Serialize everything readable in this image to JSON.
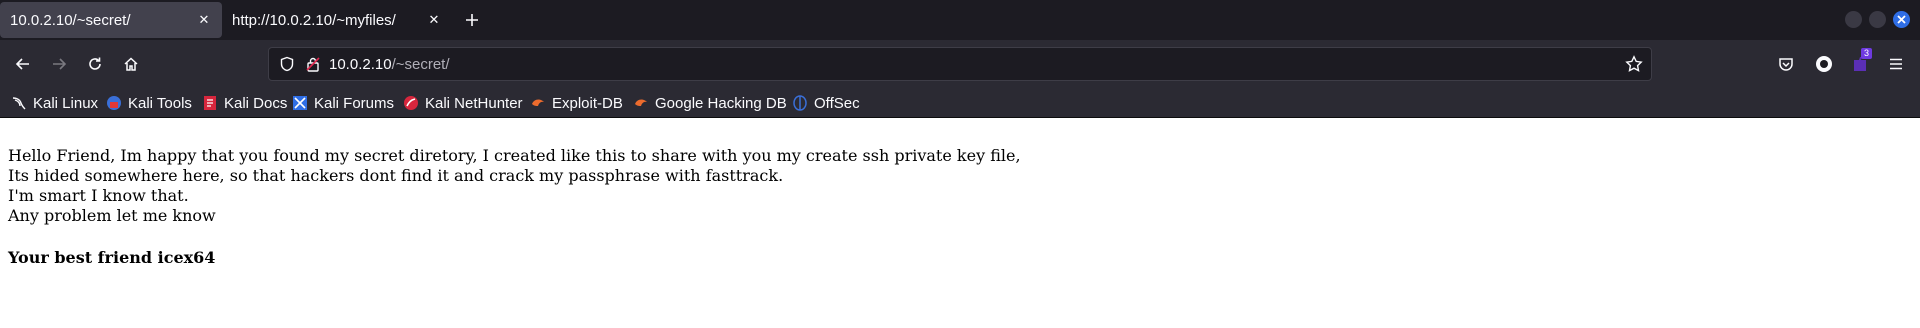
{
  "tabs": [
    {
      "title": "10.0.2.10/~secret/",
      "active": true
    },
    {
      "title": "http://10.0.2.10/~myfiles/",
      "active": false
    }
  ],
  "url": {
    "host": "10.0.2.10",
    "path": "/~secret/"
  },
  "bookmarks": [
    {
      "label": "Kali Linux",
      "icon": "kali-dragon-icon"
    },
    {
      "label": "Kali Tools",
      "icon": "kali-tools-icon"
    },
    {
      "label": "Kali Docs",
      "icon": "kali-docs-icon"
    },
    {
      "label": "Kali Forums",
      "icon": "kali-forums-icon"
    },
    {
      "label": "Kali NetHunter",
      "icon": "kali-nethunter-icon"
    },
    {
      "label": "Exploit-DB",
      "icon": "exploit-db-icon"
    },
    {
      "label": "Google Hacking DB",
      "icon": "ghdb-icon"
    },
    {
      "label": "OffSec",
      "icon": "offsec-icon"
    }
  ],
  "extension_badge": "3",
  "page": {
    "lines": [
      "Hello Friend, Im happy that you found my secret diretory, I created like this to share with you my create ssh private key file,",
      "Its hided somewhere here, so that hackers dont find it and crack my passphrase with fasttrack.",
      "I'm smart I know that.",
      "Any problem let me know"
    ],
    "signature": "Your best friend icex64"
  },
  "colors": {
    "accent": "#2f6ee6",
    "toolbar": "#2b2a33",
    "tabbar": "#1c1b22"
  }
}
